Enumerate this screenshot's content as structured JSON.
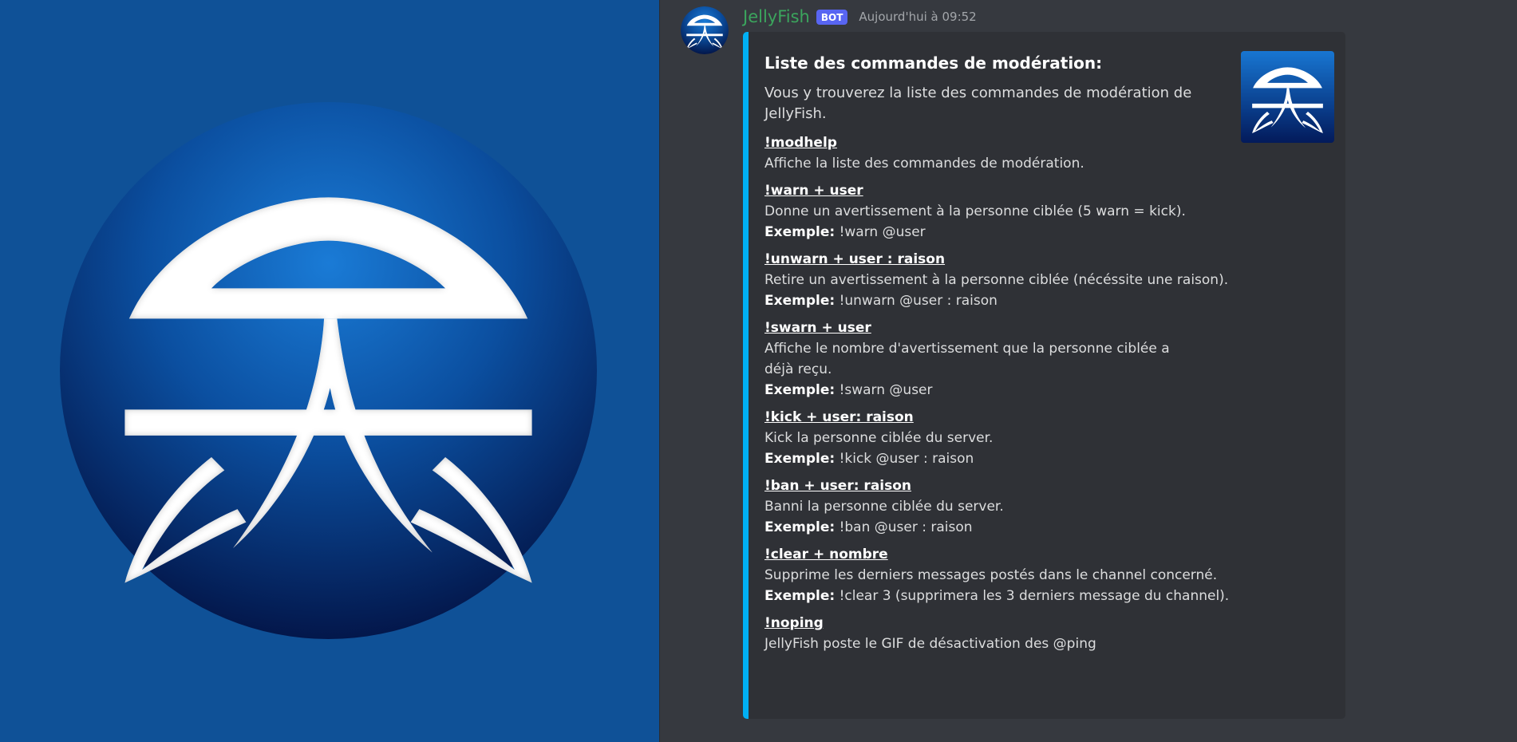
{
  "colors": {
    "left_background": "#0f5197",
    "chat_background": "#36393f",
    "embed_background": "#2f3136",
    "embed_accent": "#00b0f4",
    "username": "#3ba55d",
    "bot_tag": "#5865f2"
  },
  "message": {
    "author": "JellyFish",
    "bot_tag": "BOT",
    "timestamp": "Aujourd'hui à 09:52",
    "avatar_icon": "jellyfish-logo-icon"
  },
  "embed": {
    "title": "Liste des commandes de modération:",
    "description": "Vous y trouverez la liste des commandes de modération de JellyFish.",
    "thumbnail_icon": "jellyfish-logo-icon",
    "example_label": "Exemple:",
    "fields": [
      {
        "name": "!modhelp",
        "desc": "Affiche la liste des commandes de modération.",
        "example": null
      },
      {
        "name": "!warn + user",
        "desc": "Donne un avertissement à la personne ciblée (5 warn = kick).",
        "example": "!warn @user"
      },
      {
        "name": "!unwarn + user : raison",
        "desc": "Retire un avertissement à la personne ciblée (nécéssite une raison).",
        "example": "!unwarn @user : raison"
      },
      {
        "name": "!swarn + user",
        "desc": "Affiche le nombre d'avertissement que la personne ciblée a déjà reçu.",
        "example": "!swarn @user"
      },
      {
        "name": "!kick + user: raison",
        "desc": "Kick la personne ciblée du server.",
        "example": "!kick @user : raison"
      },
      {
        "name": "!ban + user: raison",
        "desc": "Banni la personne ciblée du server.",
        "example": "!ban @user : raison"
      },
      {
        "name": "!clear + nombre",
        "desc": "Supprime les derniers messages postés dans le channel concerné.",
        "example": "!clear 3 (supprimera les 3 derniers message du channel)."
      },
      {
        "name": "!noping",
        "desc": "JellyFish poste le GIF de désactivation des @ping",
        "example": null
      }
    ]
  }
}
